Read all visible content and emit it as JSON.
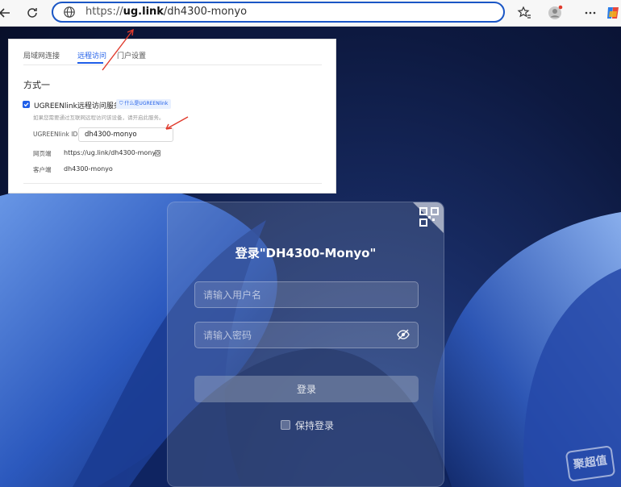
{
  "browser": {
    "url_scheme": "https://",
    "url_host": "ug.link",
    "url_path": "/dh4300-monyo",
    "icons": [
      "back-arrow-icon",
      "reload-icon",
      "globe-icon",
      "favorites-icon",
      "profile-icon",
      "more-icon",
      "copilot-icon"
    ],
    "accent": "#1a56c5"
  },
  "settings": {
    "tabs": [
      {
        "label": "局域网连接"
      },
      {
        "label": "远程访问"
      },
      {
        "label": "门户设置"
      }
    ],
    "active_tab": "远程访问",
    "section_title": "方式一",
    "service_label": "UGREENlink远程访问服务",
    "service_checked": true,
    "whatis_badge": "什么是UGREENlink",
    "hint": "如果您需要通过互联网远程访问该设备，请开启此服务。",
    "id_label": "UGREENlink ID",
    "id_value": "dh4300-monyo",
    "web_label": "网页端",
    "web_value": "https://ug.link/dh4300-monyo",
    "client_label": "客户端",
    "client_value": "dh4300-monyo",
    "accent": "#1f5ee8"
  },
  "login": {
    "title": "登录\"DH4300-Monyo\"",
    "username_placeholder": "请输入用户名",
    "password_placeholder": "请输入密码",
    "submit_label": "登录",
    "remember_label": "保持登录",
    "remember_checked": false
  },
  "watermark": {
    "text": "聚超值"
  },
  "annotations": {
    "arrow_color": "#e03a2c"
  }
}
